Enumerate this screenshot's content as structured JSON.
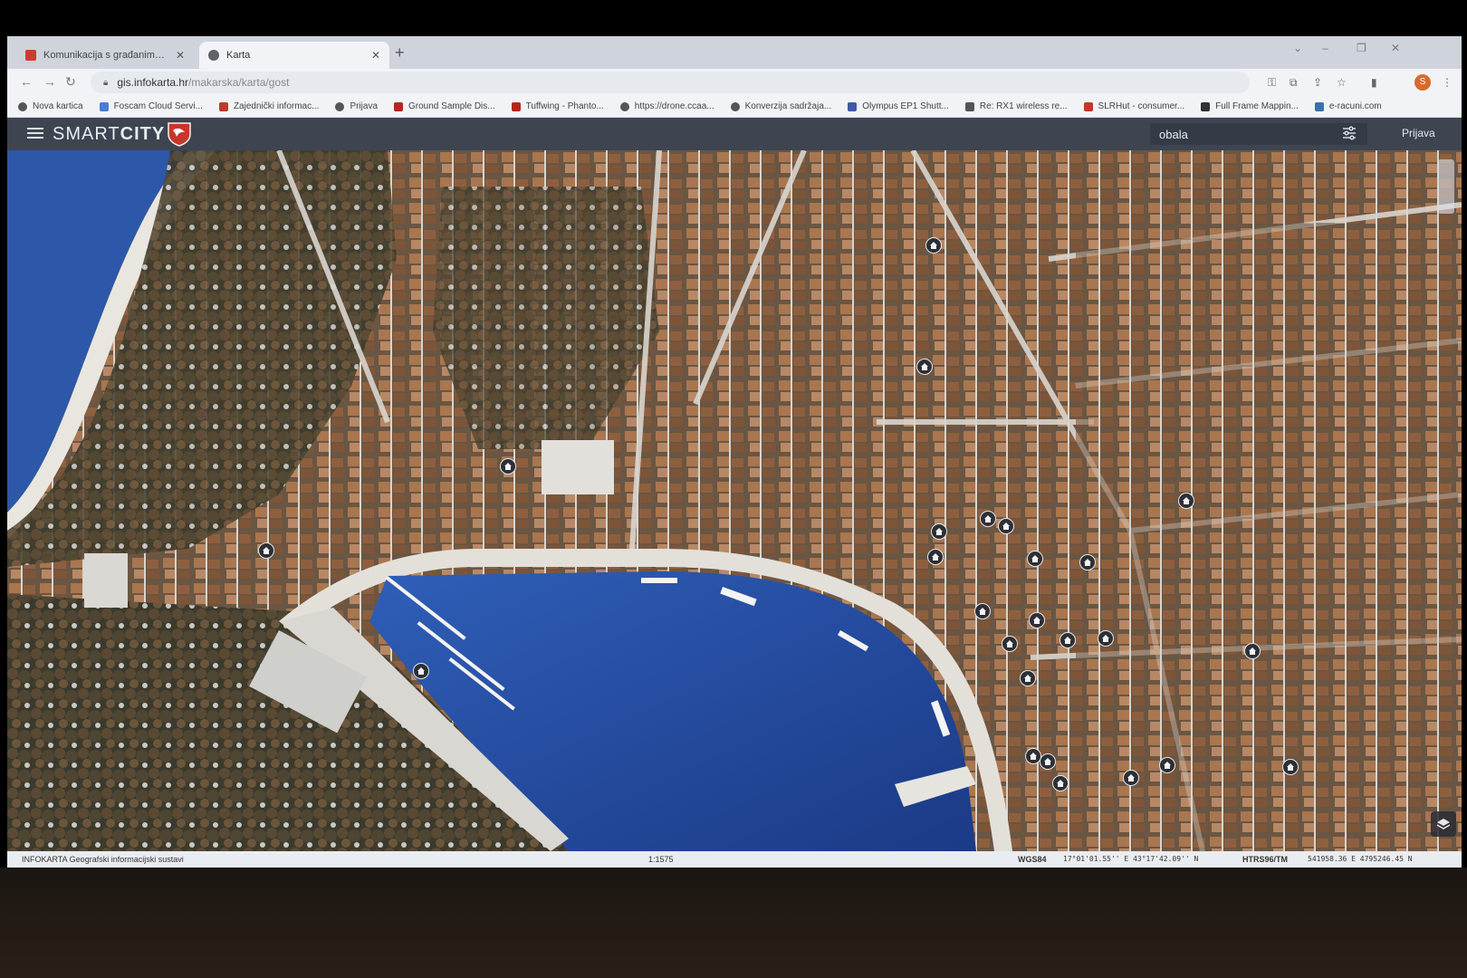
{
  "tabs": [
    {
      "title": "Komunikacija s građanima | Gra",
      "favicon_color": "#d23b2f",
      "active": false
    },
    {
      "title": "Karta",
      "favicon_color": "#5f6368",
      "active": true
    }
  ],
  "new_tab_symbol": "+",
  "window_controls": {
    "minimize": "–",
    "restore": "❐",
    "close": "✕"
  },
  "address": {
    "host": "gis.infokarta.hr",
    "path": "/makarska/karta/gost"
  },
  "profile_initial": "S",
  "bookmarks": [
    {
      "label": "Nova kartica",
      "icon": "globe-icon",
      "color": "#555"
    },
    {
      "label": "Foscam Cloud Servi...",
      "icon": "cloud-icon",
      "color": "#4a7bd6"
    },
    {
      "label": "Zajednički informac...",
      "icon": "site-icon",
      "color": "#c0392b"
    },
    {
      "label": "Prijava",
      "icon": "globe-icon",
      "color": "#555"
    },
    {
      "label": "Ground Sample Dis...",
      "icon": "square-icon",
      "color": "#b3261e"
    },
    {
      "label": "Tuffwing - Phanto...",
      "icon": "square-icon",
      "color": "#b3261e"
    },
    {
      "label": "https://drone.ccaa...",
      "icon": "globe-icon",
      "color": "#555"
    },
    {
      "label": "Konverzija sadržaja...",
      "icon": "globe-icon",
      "color": "#555"
    },
    {
      "label": "Olympus EP1 Shutt...",
      "icon": "site-icon",
      "color": "#3b5ba5"
    },
    {
      "label": "Re: RX1 wireless re...",
      "icon": "site-icon",
      "color": "#555"
    },
    {
      "label": "SLRHut - consumer...",
      "icon": "site-icon",
      "color": "#c0392b"
    },
    {
      "label": "Full Frame Mappin...",
      "icon": "site-icon",
      "color": "#333"
    },
    {
      "label": "e-racuni.com",
      "icon": "site-icon",
      "color": "#3b6fb5"
    }
  ],
  "app": {
    "logo_light": "SMART",
    "logo_bold": "CITY",
    "search_value": "obala",
    "login_label": "Prijava",
    "accent_color": "#c8352b",
    "header_color": "#3e4551"
  },
  "map": {
    "pins": [
      {
        "place": "house-marker"
      },
      {
        "place": "house-marker"
      },
      {
        "place": "house-marker"
      },
      {
        "place": "house-marker"
      },
      {
        "place": "house-marker"
      },
      {
        "place": "house-marker"
      },
      {
        "place": "house-marker"
      },
      {
        "place": "house-marker"
      },
      {
        "place": "house-marker"
      },
      {
        "place": "house-marker"
      },
      {
        "place": "house-marker"
      },
      {
        "place": "house-marker"
      },
      {
        "place": "house-marker"
      },
      {
        "place": "house-marker"
      },
      {
        "place": "house-marker"
      },
      {
        "place": "house-marker"
      },
      {
        "place": "house-marker"
      },
      {
        "place": "house-marker"
      },
      {
        "place": "house-marker"
      },
      {
        "place": "house-marker"
      },
      {
        "place": "house-marker"
      },
      {
        "place": "house-marker"
      },
      {
        "place": "house-marker"
      },
      {
        "place": "house-marker"
      },
      {
        "place": "house-marker"
      }
    ]
  },
  "statusbar": {
    "brand": "INFOKARTA Geografski informacijski sustavi",
    "scale": "1:1575",
    "crs1": "WGS84",
    "coord1": "17°01'01.55'' E 43°17'42.09'' N",
    "crs2": "HTRS96/TM",
    "coord2": "541958.36 E 4795246.45 N"
  }
}
